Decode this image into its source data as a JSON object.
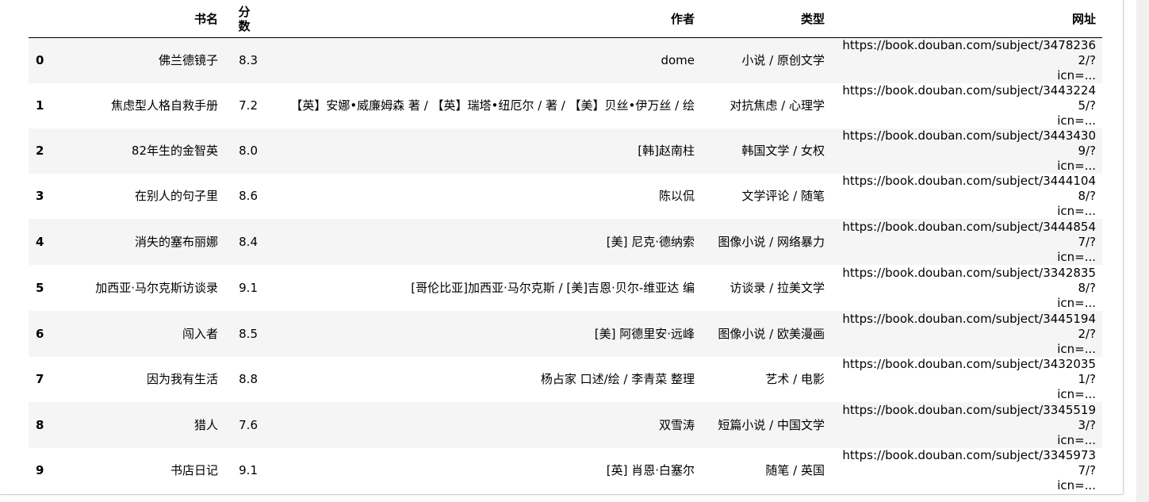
{
  "table": {
    "columns": {
      "title": "书名",
      "score_line1": "分",
      "score_line2": "数",
      "author": "作者",
      "type": "类型",
      "url": "网址"
    },
    "rows": [
      {
        "index": "0",
        "title": "佛兰德镜子",
        "score": "8.3",
        "author": "dome",
        "type": "小说 / 原创文学",
        "url_line1": "https://book.douban.com/subject/34782362/?",
        "url_line2": "icn=..."
      },
      {
        "index": "1",
        "title": "焦虑型人格自救手册",
        "score": "7.2",
        "author": "【英】安娜•威廉姆森 著 / 【英】瑞塔•纽厄尔 / 著 / 【美】贝丝•伊万丝 / 绘",
        "type": "对抗焦虑 / 心理学",
        "url_line1": "https://book.douban.com/subject/34432245/?",
        "url_line2": "icn=..."
      },
      {
        "index": "2",
        "title": "82年生的金智英",
        "score": "8.0",
        "author": "[韩]赵南柱",
        "type": "韩国文学 / 女权",
        "url_line1": "https://book.douban.com/subject/34434309/?",
        "url_line2": "icn=..."
      },
      {
        "index": "3",
        "title": "在别人的句子里",
        "score": "8.6",
        "author": "陈以侃",
        "type": "文学评论 / 随笔",
        "url_line1": "https://book.douban.com/subject/34441048/?",
        "url_line2": "icn=..."
      },
      {
        "index": "4",
        "title": "消失的塞布丽娜",
        "score": "8.4",
        "author": "[美] 尼克·德纳索",
        "type": "图像小说 / 网络暴力",
        "url_line1": "https://book.douban.com/subject/34448547/?",
        "url_line2": "icn=..."
      },
      {
        "index": "5",
        "title": "加西亚·马尔克斯访谈录",
        "score": "9.1",
        "author": "[哥伦比亚]加西亚·马尔克斯 / [美]吉恩·贝尔-维亚达 编",
        "type": "访谈录 / 拉美文学",
        "url_line1": "https://book.douban.com/subject/33428358/?",
        "url_line2": "icn=..."
      },
      {
        "index": "6",
        "title": "闯入者",
        "score": "8.5",
        "author": "[美] 阿德里安·远峰",
        "type": "图像小说 / 欧美漫画",
        "url_line1": "https://book.douban.com/subject/34451942/?",
        "url_line2": "icn=..."
      },
      {
        "index": "7",
        "title": "因为我有生活",
        "score": "8.8",
        "author": "杨占家 口述/绘 / 李青菜 整理",
        "type": "艺术 / 电影",
        "url_line1": "https://book.douban.com/subject/34320351/?",
        "url_line2": "icn=..."
      },
      {
        "index": "8",
        "title": "猎人",
        "score": "7.6",
        "author": "双雪涛",
        "type": "短篇小说 / 中国文学",
        "url_line1": "https://book.douban.com/subject/33455193/?",
        "url_line2": "icn=..."
      },
      {
        "index": "9",
        "title": "书店日记",
        "score": "9.1",
        "author": "[英] 肖恩·白塞尔",
        "type": "随笔 / 英国",
        "url_line1": "https://book.douban.com/subject/33459737/?",
        "url_line2": "icn=..."
      }
    ]
  }
}
